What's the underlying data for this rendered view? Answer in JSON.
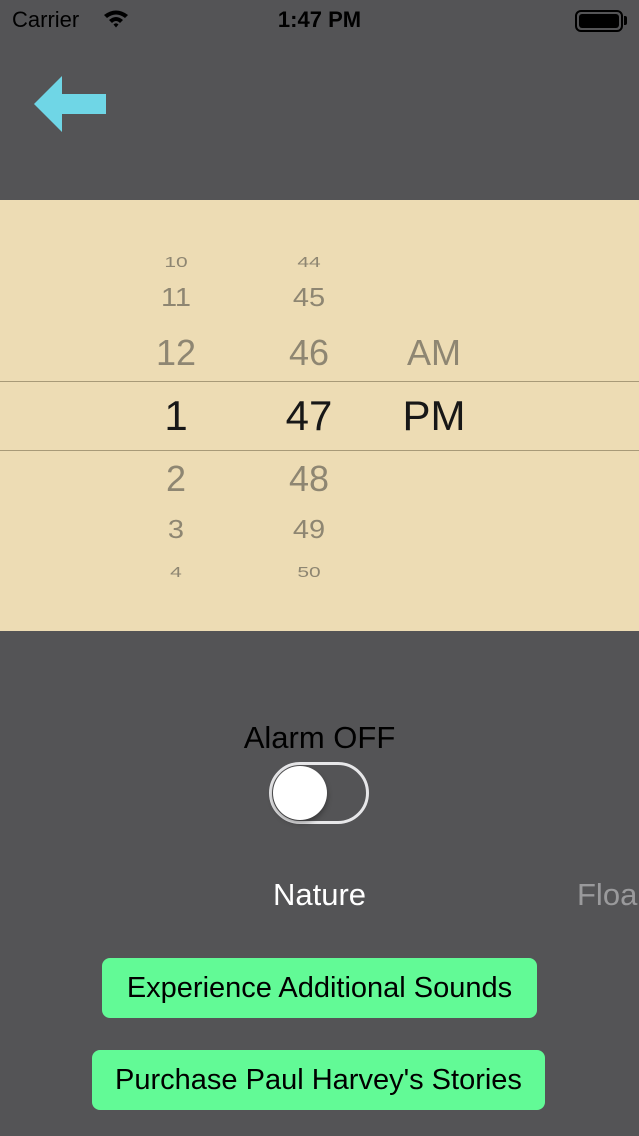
{
  "status_bar": {
    "carrier": "Carrier",
    "time": "1:47 PM",
    "wifi_icon": "wifi-icon",
    "battery_icon": "battery-icon"
  },
  "nav": {
    "back_icon": "left-arrow-icon",
    "back_color": "#6fd6e6"
  },
  "picker": {
    "background": "#eddcb4",
    "hours": [
      "10",
      "11",
      "12",
      "1",
      "2",
      "3",
      "4"
    ],
    "minutes": [
      "44",
      "45",
      "46",
      "47",
      "48",
      "49",
      "50"
    ],
    "periods": [
      "AM",
      "PM"
    ],
    "selected": {
      "hour": "1",
      "minute": "47",
      "period": "PM"
    }
  },
  "alarm": {
    "label": "Alarm OFF",
    "enabled": false
  },
  "categories": {
    "active": "Nature",
    "next_partial": "Floa"
  },
  "buttons": {
    "additional_sounds": "Experience Additional Sounds",
    "paul_harvey": "Purchase Paul Harvey's Stories",
    "color": "#62fa96"
  }
}
